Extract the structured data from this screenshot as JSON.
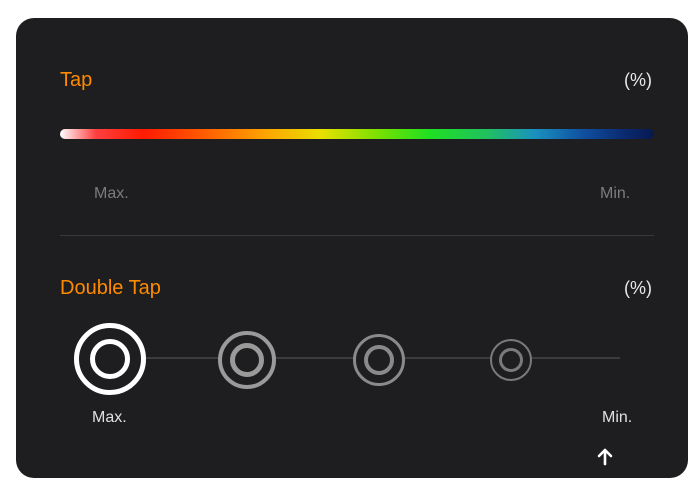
{
  "tap": {
    "title": "Tap",
    "unit": "(%)",
    "scale_max": "Max.",
    "scale_min": "Min."
  },
  "double_tap": {
    "title": "Double Tap",
    "unit": "(%)",
    "scale_max": "Max.",
    "scale_min": "Min.",
    "levels": [
      "largest",
      "large",
      "medium",
      "small"
    ],
    "selected_level": 0
  },
  "colors": {
    "accent": "#ff8a00",
    "panel_bg": "#1e1e20",
    "selected_ring": "#ffffff",
    "unselected_ring": "#9a9a9a"
  },
  "icons": {
    "collapse": "arrow-up-icon"
  }
}
